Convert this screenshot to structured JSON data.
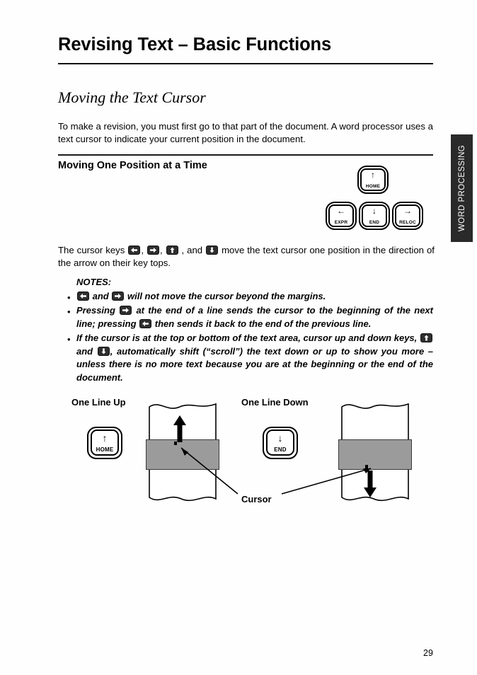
{
  "header": {
    "title": "Revising Text – Basic Functions",
    "section_title": "Moving the Text Cursor"
  },
  "body": {
    "intro_paragraph": "To make a revision, you must first go to that part of the document. A word processor uses a text cursor to indicate your current position in the document.",
    "subsection_title": "Moving One Position at a Time",
    "cursor_keys_prefix": "The cursor keys",
    "cursor_keys_mid": ", and",
    "cursor_keys_suffix": "move the text cursor one position in the direction of the arrow on their key tops."
  },
  "notes": {
    "title": "NOTES:",
    "bullet_char": "•",
    "items": [
      {
        "prefix": "",
        "mid_and": "and",
        "text": "will not move the cursor beyond the margins."
      },
      {
        "prefix": "Pressing",
        "mid": "at the end of a line sends the cursor to the beginning of the next line; pressing",
        "suffix": "then sends it back to the end of the previous line."
      },
      {
        "prefix": "If the cursor is at the top or bottom of the text area, cursor up and down keys,",
        "mid_and": "and",
        "suffix": ", automatically shift (“scroll”) the text down or up to show you more – unless there is no more text because you are at the beginning or the end of the document."
      }
    ]
  },
  "side_tab": {
    "label": "WORD PROCESSING",
    "background": "#2a2a2a",
    "text_color": "#ffffff"
  },
  "keypad": {
    "keys": [
      {
        "name": "home-key",
        "arrow": "↑",
        "label": "HOME"
      },
      {
        "name": "expr-key",
        "arrow": "←",
        "label": "EXPR"
      },
      {
        "name": "end-key",
        "arrow": "↓",
        "label": "END"
      },
      {
        "name": "reloc-key",
        "arrow": "→",
        "label": "RELOC"
      }
    ]
  },
  "figure": {
    "label_up": "One Line Up",
    "label_down": "One Line Down",
    "cursor_label": "Cursor",
    "key_up": {
      "arrow": "↑",
      "label": "HOME"
    },
    "key_down": {
      "arrow": "↓",
      "label": "END"
    },
    "band_color": "#9b9b9b"
  },
  "footer": {
    "page_number": "29"
  }
}
